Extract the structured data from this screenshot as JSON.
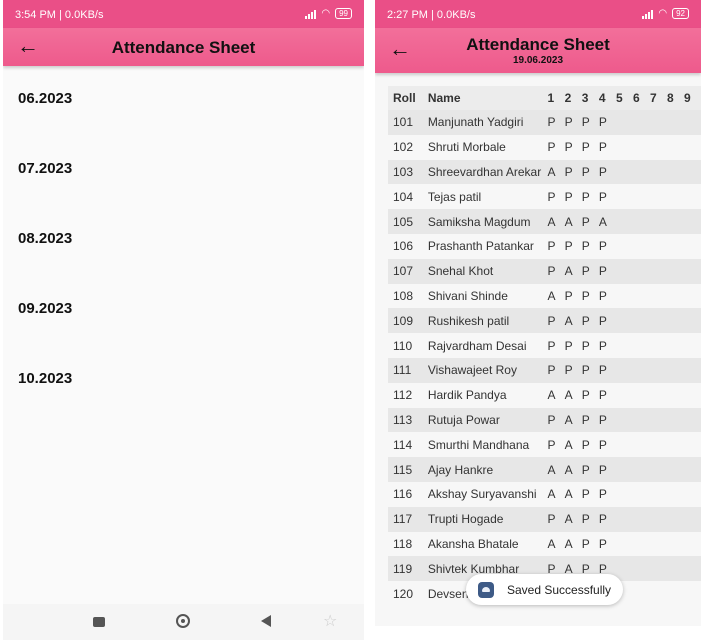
{
  "left": {
    "status": {
      "time": "3:54 PM | 0.0KB/s",
      "battery": "99"
    },
    "title": "Attendance Sheet",
    "back_icon": "←",
    "months": [
      "06.2023",
      "07.2023",
      "08.2023",
      "09.2023",
      "10.2023"
    ]
  },
  "right": {
    "status": {
      "time": "2:27 PM | 0.0KB/s",
      "battery": "92"
    },
    "title": "Attendance Sheet",
    "date": "19.06.2023",
    "back_icon": "←",
    "columns": [
      "Roll",
      "Name",
      "1",
      "2",
      "3",
      "4",
      "5",
      "6",
      "7",
      "8",
      "9"
    ],
    "rows": [
      {
        "roll": "101",
        "name": "Manjunath Yadgiri",
        "days": [
          "P",
          "P",
          "P",
          "P"
        ]
      },
      {
        "roll": "102",
        "name": "Shruti Morbale",
        "days": [
          "P",
          "P",
          "P",
          "P"
        ]
      },
      {
        "roll": "103",
        "name": "Shreevardhan Arekar",
        "days": [
          "A",
          "P",
          "P",
          "P"
        ]
      },
      {
        "roll": "104",
        "name": "Tejas patil",
        "days": [
          "P",
          "P",
          "P",
          "P"
        ]
      },
      {
        "roll": "105",
        "name": "Samiksha Magdum",
        "days": [
          "A",
          "A",
          "P",
          "A"
        ]
      },
      {
        "roll": "106",
        "name": "Prashanth Patankar",
        "days": [
          "P",
          "P",
          "P",
          "P"
        ]
      },
      {
        "roll": "107",
        "name": "Snehal Khot",
        "days": [
          "P",
          "A",
          "P",
          "P"
        ]
      },
      {
        "roll": "108",
        "name": "Shivani Shinde",
        "days": [
          "A",
          "P",
          "P",
          "P"
        ]
      },
      {
        "roll": "109",
        "name": "Rushikesh patil",
        "days": [
          "P",
          "A",
          "P",
          "P"
        ]
      },
      {
        "roll": "110",
        "name": "Rajvardham Desai",
        "days": [
          "P",
          "P",
          "P",
          "P"
        ]
      },
      {
        "roll": "111",
        "name": "Vishawajeet Roy",
        "days": [
          "P",
          "P",
          "P",
          "P"
        ]
      },
      {
        "roll": "112",
        "name": "Hardik Pandya",
        "days": [
          "A",
          "A",
          "P",
          "P"
        ]
      },
      {
        "roll": "113",
        "name": "Rutuja Powar",
        "days": [
          "P",
          "A",
          "P",
          "P"
        ]
      },
      {
        "roll": "114",
        "name": "Smurthi Mandhana",
        "days": [
          "P",
          "A",
          "P",
          "P"
        ]
      },
      {
        "roll": "115",
        "name": "Ajay Hankre",
        "days": [
          "A",
          "A",
          "P",
          "P"
        ]
      },
      {
        "roll": "116",
        "name": "Akshay Suryavanshi",
        "days": [
          "A",
          "A",
          "P",
          "P"
        ]
      },
      {
        "roll": "117",
        "name": "Trupti Hogade",
        "days": [
          "P",
          "A",
          "P",
          "P"
        ]
      },
      {
        "roll": "118",
        "name": "Akansha Bhatale",
        "days": [
          "A",
          "A",
          "P",
          "P"
        ]
      },
      {
        "roll": "119",
        "name": "Shivtek Kumbhar",
        "days": [
          "P",
          "A",
          "P",
          "P"
        ]
      },
      {
        "roll": "120",
        "name": "Devsen",
        "days": []
      }
    ],
    "toast": {
      "text": "Saved Successfully"
    }
  },
  "colors": {
    "appbar": "#ee5a8c",
    "statusbar": "#ea4f87"
  }
}
